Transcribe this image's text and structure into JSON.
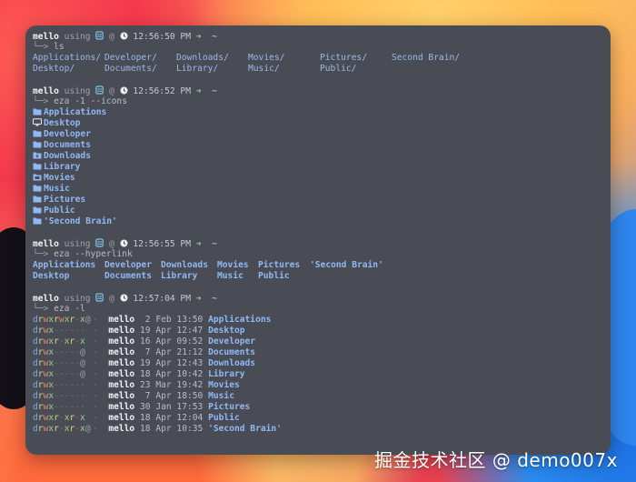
{
  "prompt_user": "mello",
  "prompt_word": "using",
  "prompt_at": "@",
  "prompt_cwd": "~",
  "blocks": [
    {
      "time": "12:56:50 PM",
      "command": "ls",
      "kind": "ls",
      "rows": [
        [
          "Applications/",
          "Developer/",
          "Downloads/",
          "Movies/",
          "Pictures/",
          "Second Brain/"
        ],
        [
          "Desktop/",
          "Documents/",
          "Library/",
          "Music/",
          "Public/"
        ]
      ]
    },
    {
      "time": "12:56:52 PM",
      "command": "eza -1 --icons",
      "kind": "icons",
      "items": [
        {
          "icon": "folder",
          "name": "Applications"
        },
        {
          "icon": "desktop",
          "name": "Desktop"
        },
        {
          "icon": "folder",
          "name": "Developer"
        },
        {
          "icon": "folder",
          "name": "Documents"
        },
        {
          "icon": "download",
          "name": "Downloads"
        },
        {
          "icon": "folder",
          "name": "Library"
        },
        {
          "icon": "movie",
          "name": "Movies"
        },
        {
          "icon": "folder",
          "name": "Music"
        },
        {
          "icon": "folder",
          "name": "Pictures"
        },
        {
          "icon": "folder",
          "name": "Public"
        },
        {
          "icon": "folder",
          "name": "'Second Brain'"
        }
      ]
    },
    {
      "time": "12:56:55 PM",
      "command": "eza --hyperlink",
      "kind": "grid",
      "rows": [
        [
          "Applications",
          "Developer",
          "Downloads",
          "Movies",
          "Pictures",
          "'Second Brain'"
        ],
        [
          "Desktop",
          "Documents",
          "Library",
          "Music",
          "Public"
        ]
      ]
    },
    {
      "time": "12:57:04 PM",
      "command": "eza -l",
      "kind": "long",
      "entries": [
        {
          "perm": "drwxrwxr-x@",
          "user": "mello",
          "date": " 2 Feb 13:50",
          "name": "Applications"
        },
        {
          "perm": "drwx------",
          "user": "mello",
          "date": "19 Apr 12:47",
          "name": "Desktop"
        },
        {
          "perm": "drwxr-xr-x",
          "user": "mello",
          "date": "16 Apr 09:52",
          "name": "Developer"
        },
        {
          "perm": "drwx-----@",
          "user": "mello",
          "date": " 7 Apr 21:12",
          "name": "Documents"
        },
        {
          "perm": "drwx-----@",
          "user": "mello",
          "date": "19 Apr 12:43",
          "name": "Downloads"
        },
        {
          "perm": "drwx-----@",
          "user": "mello",
          "date": "18 Apr 10:42",
          "name": "Library"
        },
        {
          "perm": "drwx------",
          "user": "mello",
          "date": "23 Mar 19:42",
          "name": "Movies"
        },
        {
          "perm": "drwx------",
          "user": "mello",
          "date": " 7 Apr 18:50",
          "name": "Music"
        },
        {
          "perm": "drwx------",
          "user": "mello",
          "date": "30 Jan 17:53",
          "name": "Pictures"
        },
        {
          "perm": "drwxr-xr-x",
          "user": "mello",
          "date": "18 Apr 12:04",
          "name": "Public"
        },
        {
          "perm": "drwxr-xr-x@",
          "user": "mello",
          "date": "18 Apr 10:35",
          "name": "'Second Brain'"
        }
      ]
    }
  ],
  "watermark": "掘金技术社区 @ demo007x",
  "colors": {
    "terminal_bg": "#4a4c55",
    "dir_blue": "#8fb8f4",
    "prompt_green": "#8fd48a"
  }
}
